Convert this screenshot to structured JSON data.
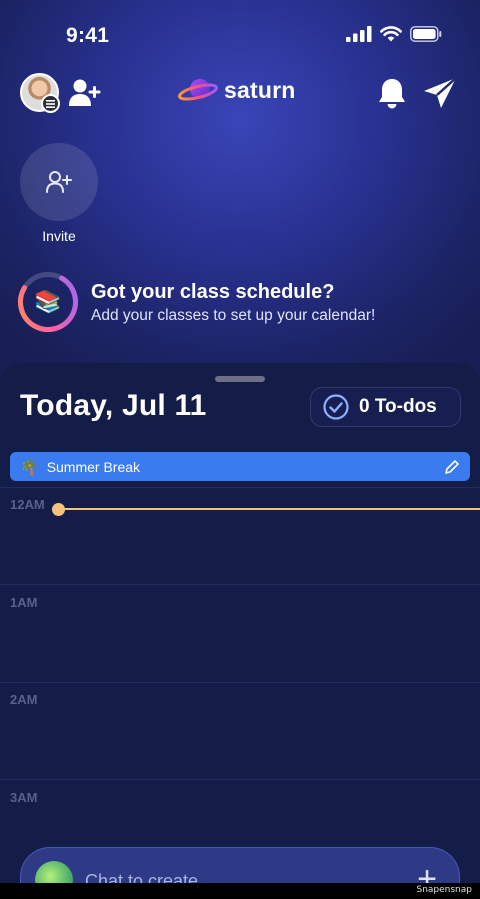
{
  "status_bar": {
    "time": "9:41"
  },
  "header": {
    "logo_text": "saturn"
  },
  "invite": {
    "label": "Invite"
  },
  "schedule_prompt": {
    "emoji": "📚",
    "title": "Got your class schedule?",
    "subtitle": "Add your classes to set up your calendar!"
  },
  "calendar": {
    "date_title": "Today, Jul 11",
    "todos_label": "0 To-dos",
    "all_day_event": {
      "emoji": "🌴",
      "label": "Summer Break"
    },
    "hours": [
      "12AM",
      "1AM",
      "2AM",
      "3AM"
    ]
  },
  "chat": {
    "placeholder": "Chat to create"
  },
  "watermark": "Snapensnap",
  "colors": {
    "accent_blue": "#3a7bf0",
    "now_line": "#f4c27a",
    "sheet_bg": "#141c48"
  }
}
